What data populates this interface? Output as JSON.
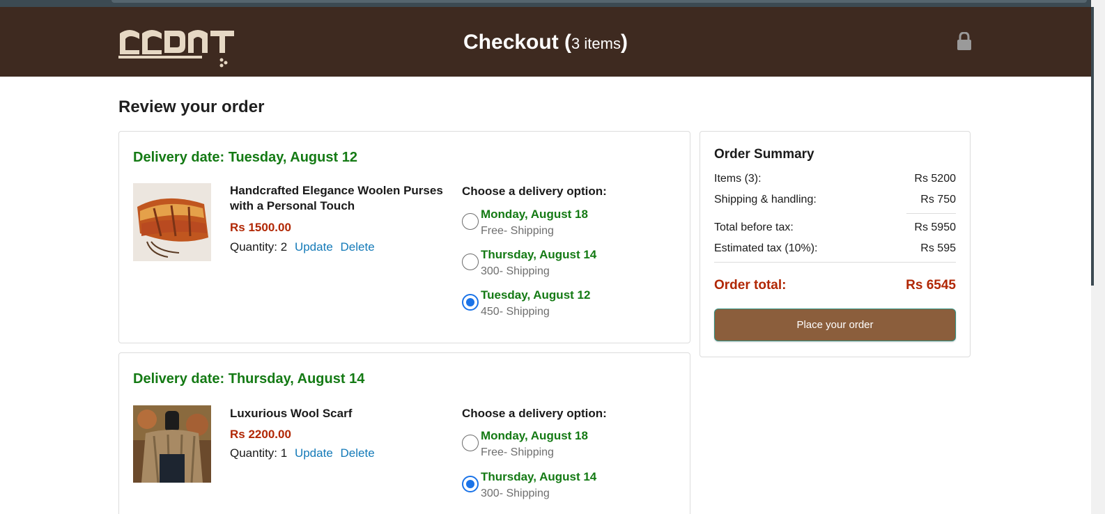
{
  "header": {
    "logo_text": "PADOSI",
    "title": "Checkout",
    "paren_open": "(",
    "items_count": "3 items",
    "paren_close": ")"
  },
  "page_title": "Review your order",
  "orders": [
    {
      "delivery_date": "Delivery date: Tuesday, August 12",
      "product_name": "Handcrafted Elegance Woolen Purses with a Personal Touch",
      "price": "Rs 1500.00",
      "quantity_label": "Quantity: 2",
      "update_label": "Update",
      "delete_label": "Delete",
      "options_title": "Choose a delivery option:",
      "options": [
        {
          "date": "Monday, August 18",
          "shipping": "Free- Shipping",
          "selected": false
        },
        {
          "date": "Thursday, August 14",
          "shipping": "300- Shipping",
          "selected": false
        },
        {
          "date": "Tuesday, August 12",
          "shipping": "450- Shipping",
          "selected": true
        }
      ]
    },
    {
      "delivery_date": "Delivery date: Thursday, August 14",
      "product_name": "Luxurious Wool Scarf",
      "price": "Rs 2200.00",
      "quantity_label": "Quantity: 1",
      "update_label": "Update",
      "delete_label": "Delete",
      "options_title": "Choose a delivery option:",
      "options": [
        {
          "date": "Monday, August 18",
          "shipping": "Free- Shipping",
          "selected": false
        },
        {
          "date": "Thursday, August 14",
          "shipping": "300- Shipping",
          "selected": true
        }
      ]
    }
  ],
  "summary": {
    "title": "Order Summary",
    "rows": [
      {
        "label": "Items (3):",
        "value": "Rs 5200"
      },
      {
        "label": "Shipping & handling:",
        "value": "Rs 750"
      },
      {
        "label": "Total before tax:",
        "value": "Rs 5950"
      },
      {
        "label": "Estimated tax (10%):",
        "value": "Rs 595"
      }
    ],
    "total_label": "Order total:",
    "total_value": "Rs 6545",
    "button_label": "Place your order"
  },
  "colors": {
    "header_bg": "#3e2a20",
    "delivery_green": "#147a14",
    "price_red": "#b12704",
    "link_blue": "#147ab8",
    "button_brown": "#8b5e3c",
    "radio_blue": "#1a73e8"
  },
  "icons": [
    "lock-icon",
    "logo-mark"
  ]
}
